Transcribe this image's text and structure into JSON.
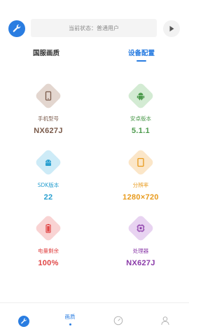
{
  "header": {
    "status_text": "当前状态：普通用户"
  },
  "tabs": [
    {
      "label": "国服画质",
      "active": false
    },
    {
      "label": "设备配置",
      "active": true
    }
  ],
  "cards": [
    {
      "label": "手机型号",
      "value": "NX627J",
      "color": "#7a5a4a",
      "tile": "#e3d6cf",
      "icon": "phone-icon"
    },
    {
      "label": "安卓版本",
      "value": "5.1.1",
      "color": "#4c9a4c",
      "tile": "#d3ebd3",
      "icon": "android-icon"
    },
    {
      "label": "SDK版本",
      "value": "22",
      "color": "#2aa0d0",
      "tile": "#cdebf7",
      "icon": "android-head-icon"
    },
    {
      "label": "分辨率",
      "value": "1280×720",
      "color": "#e89a1c",
      "tile": "#fbe6c8",
      "icon": "tablet-icon"
    },
    {
      "label": "电量剩余",
      "value": "100%",
      "color": "#e04545",
      "tile": "#f9d3d3",
      "icon": "battery-icon"
    },
    {
      "label": "处理器",
      "value": "NX627J",
      "color": "#8a3aa8",
      "tile": "#e8d3f1",
      "icon": "chip-icon"
    }
  ],
  "bottom_nav": {
    "active_label": "画质"
  },
  "colors": {
    "accent": "#2a7de1"
  }
}
